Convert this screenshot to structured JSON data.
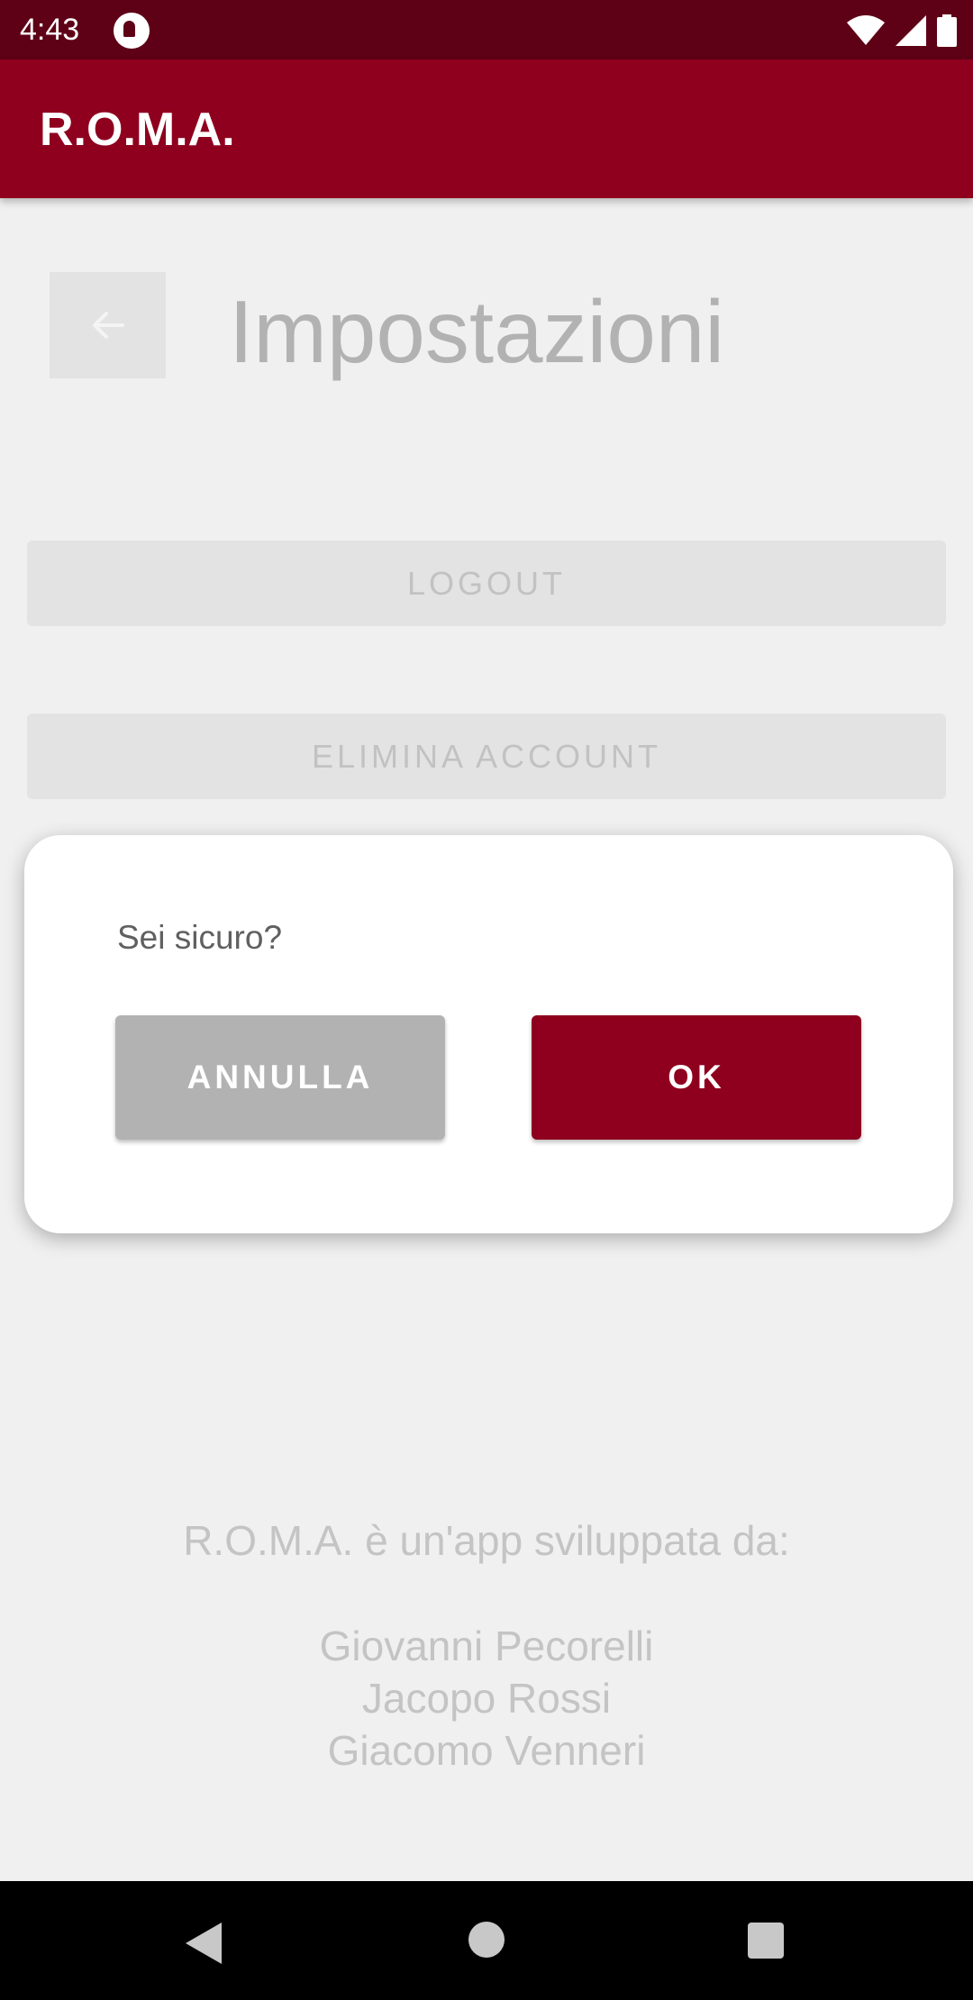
{
  "status_bar": {
    "time": "4:43",
    "icons": [
      "app-notification-icon",
      "wifi-icon",
      "signal-icon",
      "battery-icon"
    ]
  },
  "app_bar": {
    "title": "R.O.M.A."
  },
  "settings": {
    "back_icon": "arrow-left-icon",
    "title": "Impostazioni",
    "logout_label": "LOGOUT",
    "delete_account_label": "ELIMINA ACCOUNT"
  },
  "credits": {
    "intro": "R.O.M.A. è un'app sviluppata da:",
    "authors": [
      "Giovanni Pecorelli",
      "Jacopo Rossi",
      "Giacomo Venneri"
    ]
  },
  "dialog": {
    "message": "Sei sicuro?",
    "cancel_label": "ANNULLA",
    "ok_label": "OK"
  },
  "nav_bar": {
    "icons": [
      "back-icon",
      "home-icon",
      "recents-icon"
    ]
  },
  "colors": {
    "status_bar": "#5e0016",
    "primary": "#8e001e",
    "background": "#f0f0f0",
    "disabled_button": "#e3e3e3",
    "cancel_button": "#b2b2b2"
  }
}
